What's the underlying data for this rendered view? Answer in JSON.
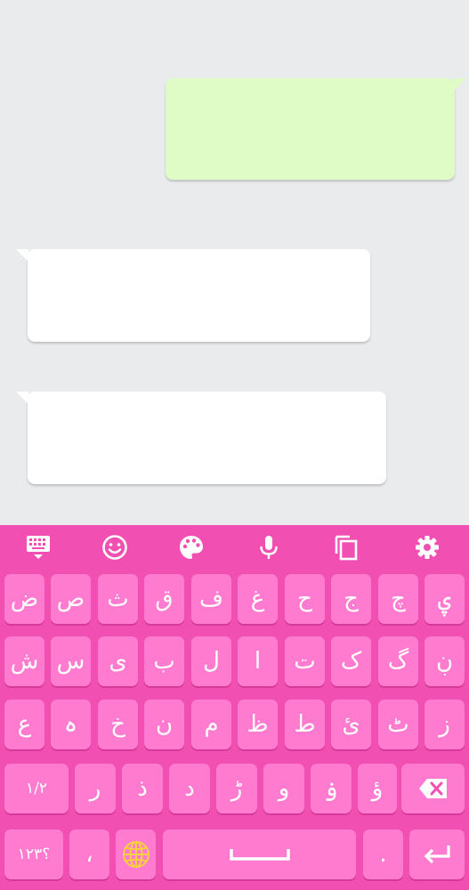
{
  "chat": {
    "messages": [
      {
        "direction": "outgoing",
        "text": ""
      },
      {
        "direction": "incoming",
        "text": ""
      },
      {
        "direction": "incoming",
        "text": ""
      }
    ]
  },
  "keyboard": {
    "colors": {
      "background": "#f24fb2",
      "key": "#ff7bd0",
      "text": "#ffffff"
    },
    "toolbar": {
      "icons": [
        "keyboard-hide-icon",
        "emoji-icon",
        "palette-icon",
        "microphone-icon",
        "clipboard-icon",
        "settings-gear-icon"
      ]
    },
    "row1": [
      "ض",
      "ص",
      "ث",
      "ق",
      "ف",
      "غ",
      "ح",
      "ج",
      "چ",
      "ۑ"
    ],
    "row2": [
      "ش",
      "س",
      "ی",
      "ب",
      "ل",
      "ا",
      "ت",
      "ک",
      "گ",
      "ڹ"
    ],
    "row3": [
      "ع",
      "ہ",
      "خ",
      "ن",
      "م",
      "ظ",
      "ط",
      "ئ",
      "ٹ",
      "ز"
    ],
    "row4": {
      "shift_label": "١/٢",
      "letters": [
        "ر",
        "ذ",
        "د",
        "ڑ",
        "و",
        "ۏ",
        "ؤ"
      ]
    },
    "row5": {
      "symbols_label": "؟١٢٣",
      "comma": "،",
      "period": "."
    }
  }
}
